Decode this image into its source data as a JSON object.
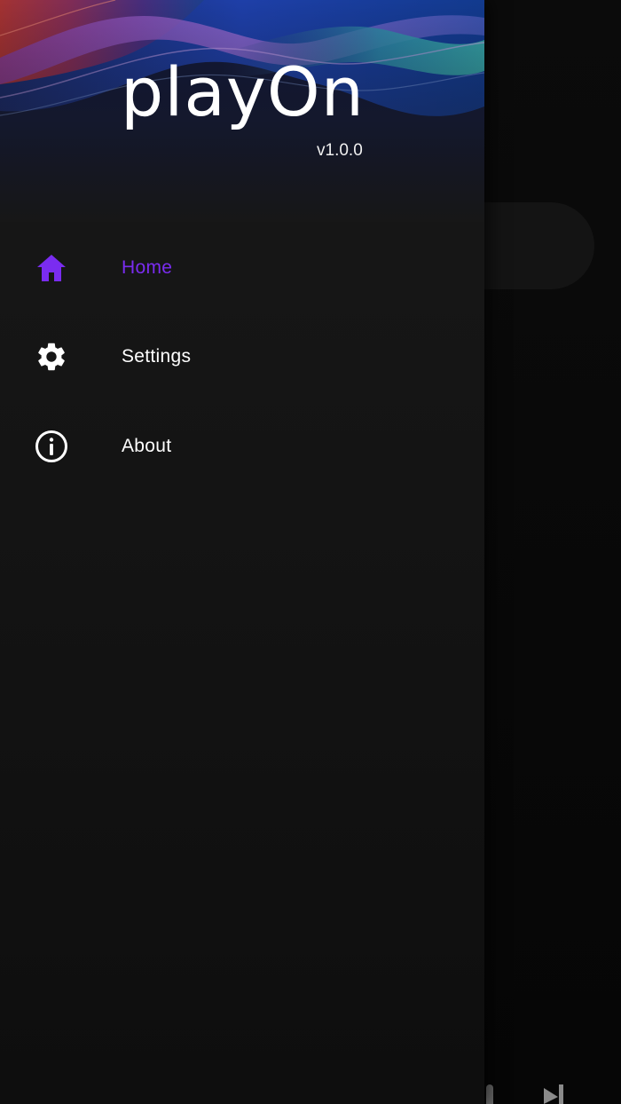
{
  "app": {
    "title": "playOn",
    "version": "v1.0.0"
  },
  "colors": {
    "accent": "#7a2cf0",
    "drawer_background": "#141414",
    "text_primary": "#ffffff"
  },
  "drawer": {
    "items": [
      {
        "label": "Home",
        "icon": "home-icon",
        "active": true
      },
      {
        "label": "Settings",
        "icon": "gear-icon",
        "active": false
      },
      {
        "label": "About",
        "icon": "info-icon",
        "active": false
      }
    ]
  },
  "background_app": {
    "player_controls": [
      {
        "icon": "pause-icon"
      },
      {
        "icon": "skip-next-icon"
      }
    ]
  }
}
